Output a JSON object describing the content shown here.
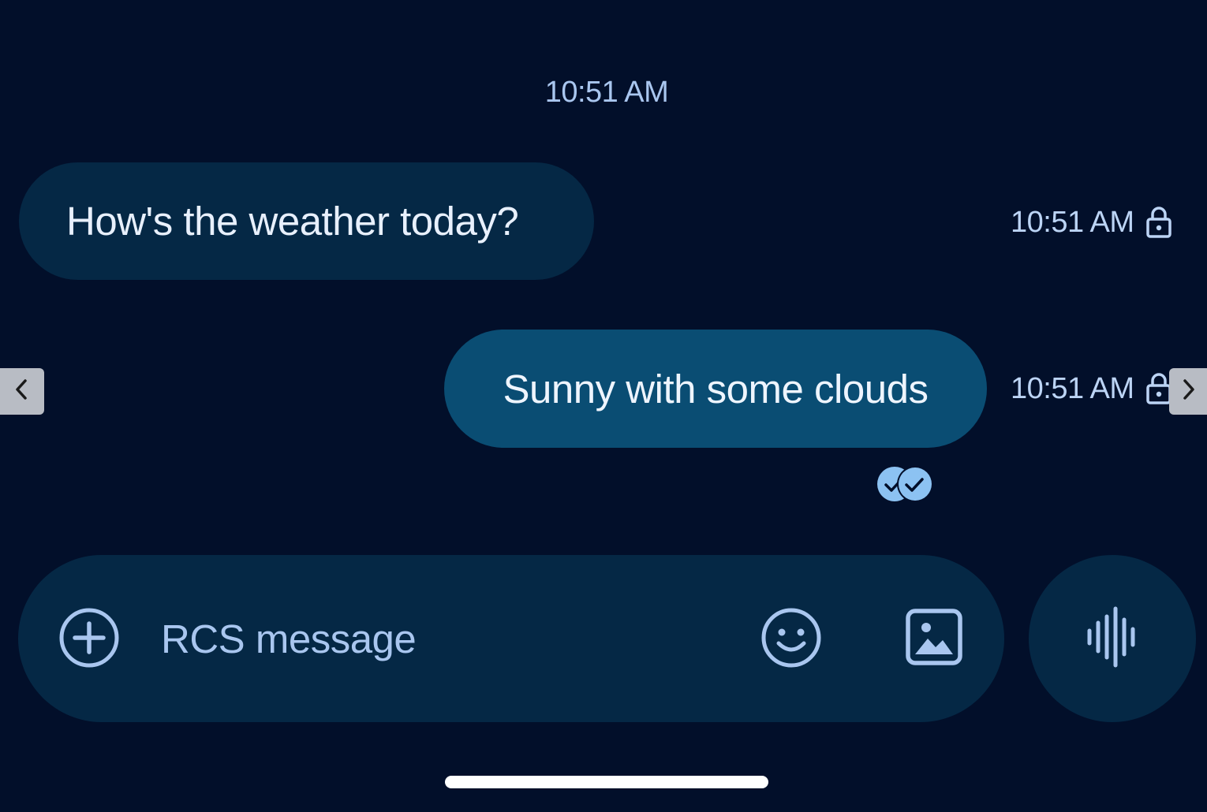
{
  "conversation": {
    "date_stamp": "10:51 AM",
    "messages": [
      {
        "direction": "incoming",
        "text": "How's the weather today?",
        "time": "10:51 AM",
        "status_icon": "lock-icon"
      },
      {
        "direction": "outgoing",
        "text": "Sunny with some clouds",
        "time": "10:51 AM",
        "status_icon": "lock-icon",
        "receipt_icon": "read-receipt-icon"
      }
    ]
  },
  "composer": {
    "placeholder": "RCS message",
    "value": "",
    "add_icon": "plus-circle-icon",
    "emoji_icon": "emoji-icon",
    "gallery_icon": "image-icon",
    "voice_icon": "voice-wave-icon"
  },
  "navigation": {
    "prev_icon": "chevron-left-icon",
    "next_icon": "chevron-right-icon"
  },
  "colors": {
    "background": "#020f2a",
    "incoming_bubble": "#052845",
    "outgoing_bubble": "#0a4d73",
    "accent": "#a9c6ef",
    "receipt": "#8cc2f2"
  }
}
